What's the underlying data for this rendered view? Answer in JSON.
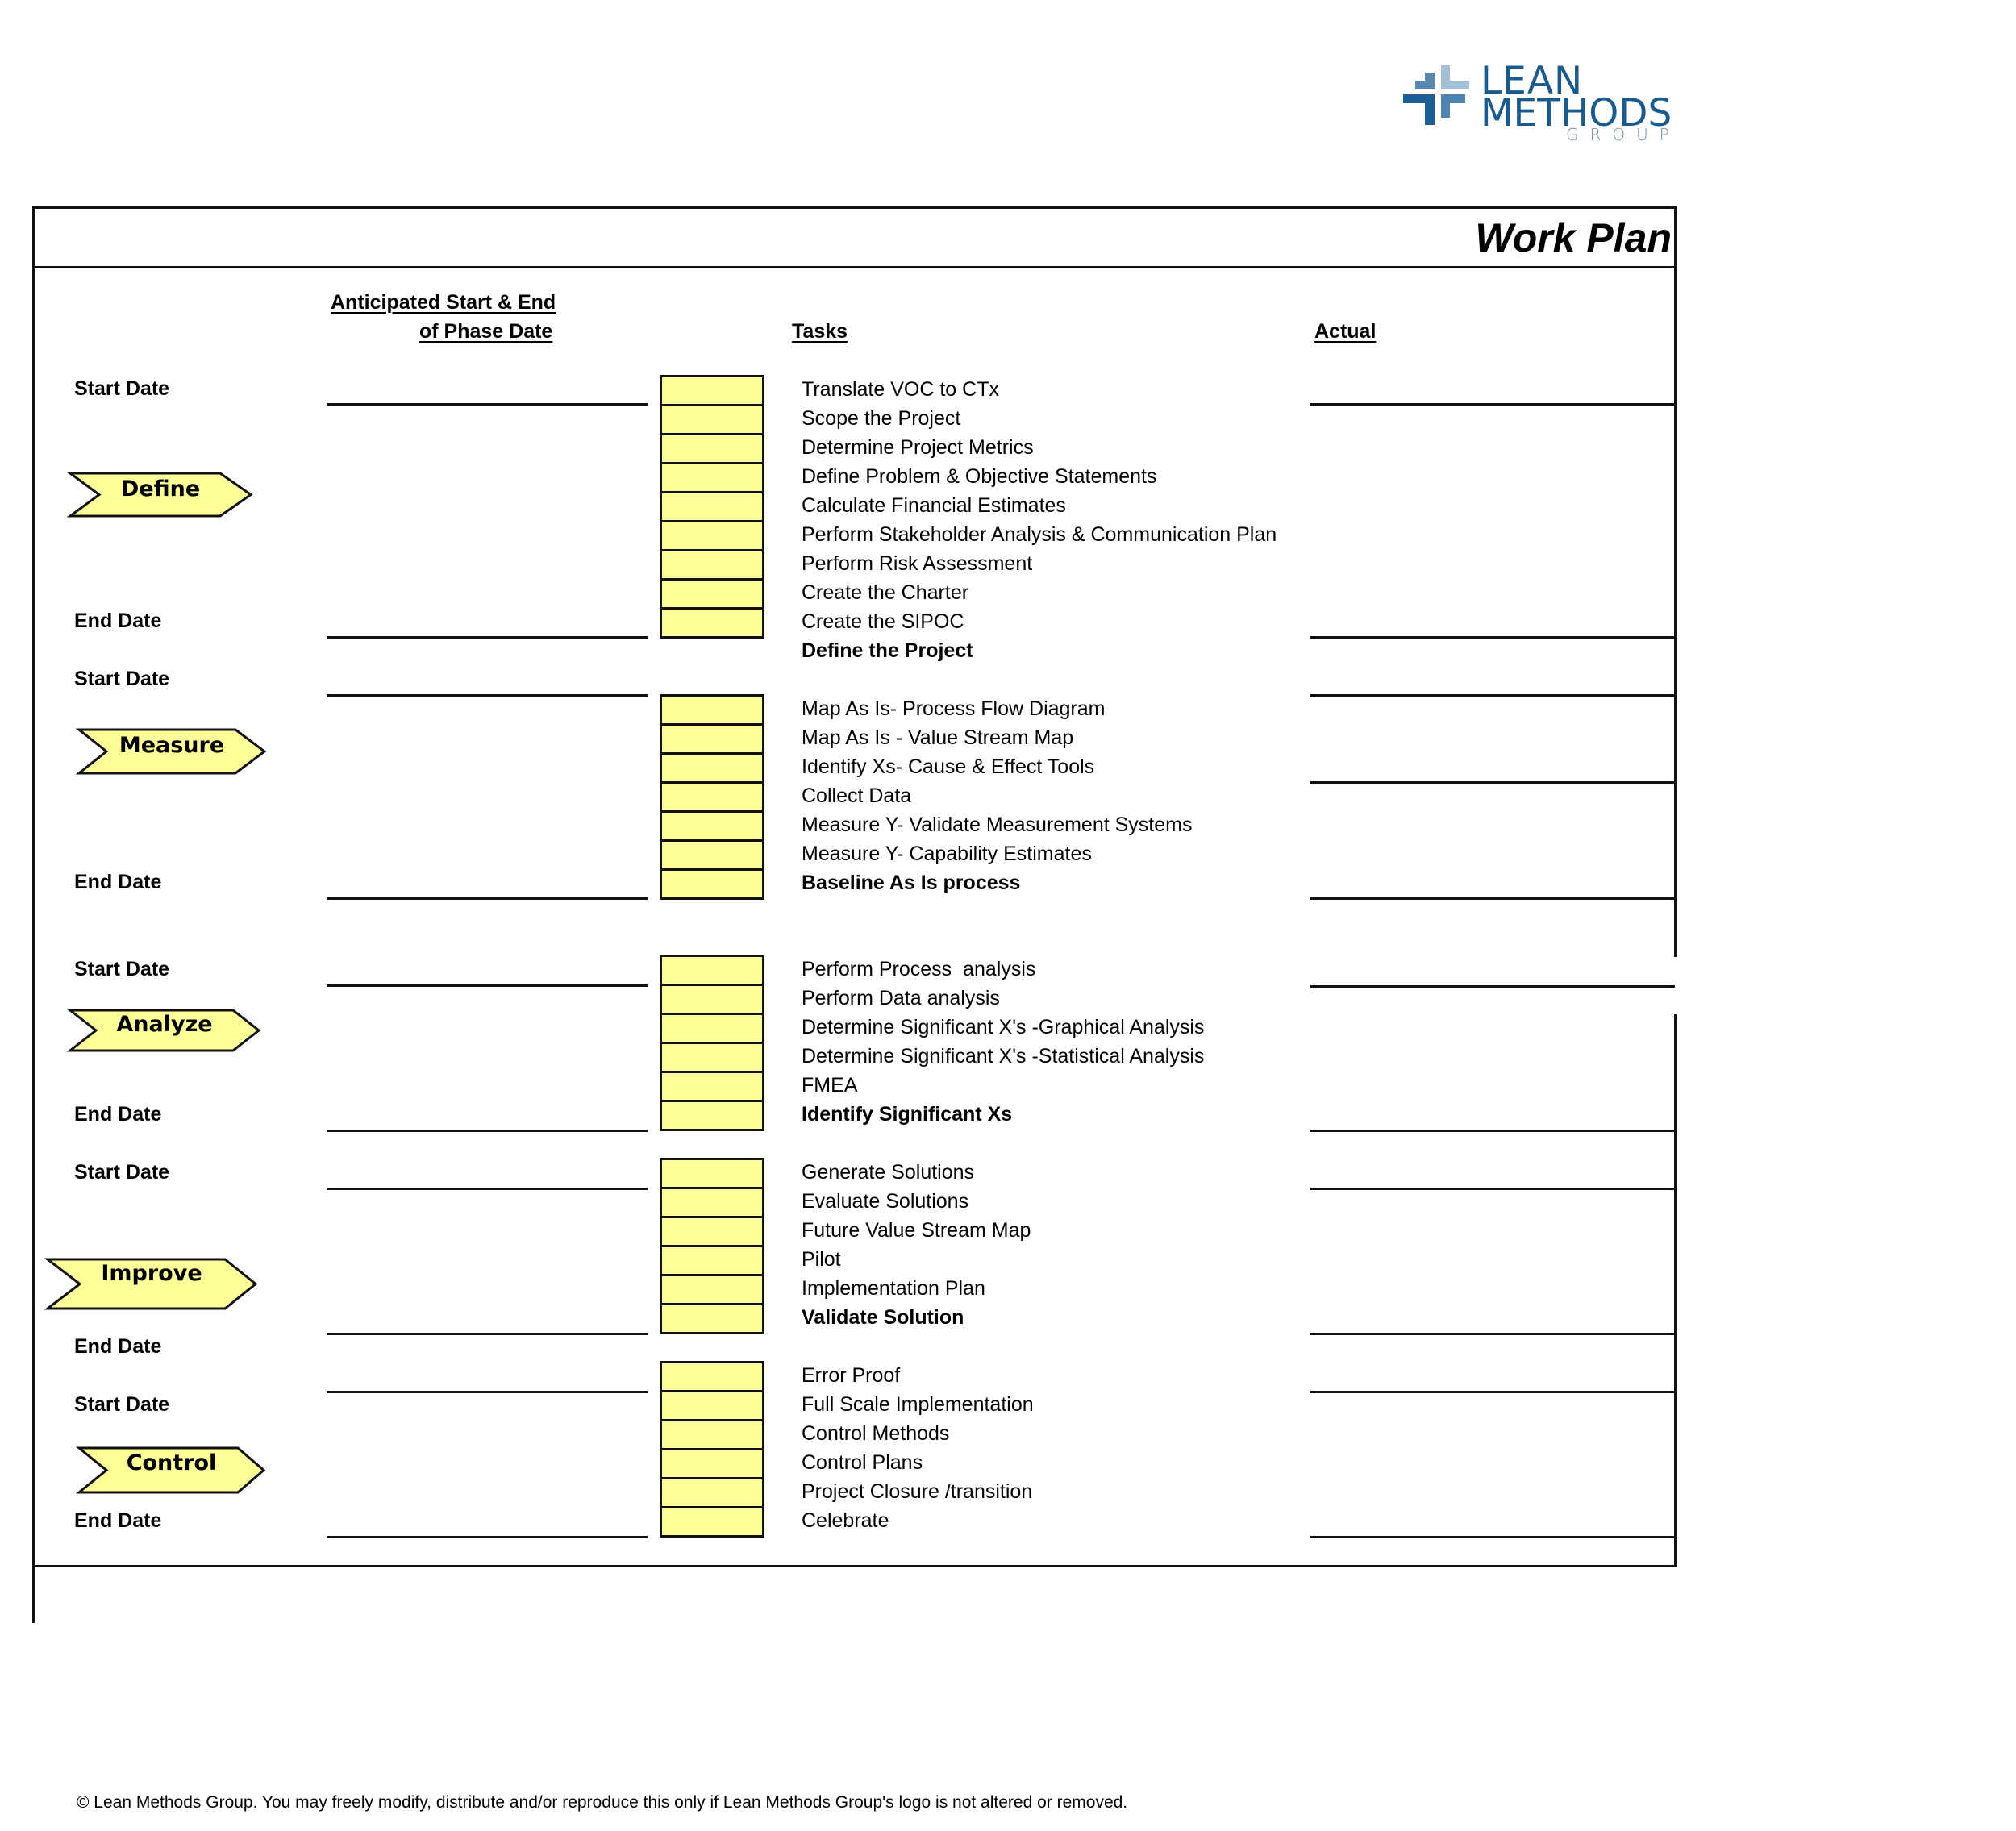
{
  "logo": {
    "line1": "LEAN",
    "line2": "METHODS",
    "line3": "GROUP",
    "colors": {
      "dark": "#1c5f96",
      "mid": "#4f83b0",
      "mid_light": "#5b87ad",
      "light": "#a4bfd5",
      "text": "#1b5a8d",
      "group_text": "#6f8ea6"
    }
  },
  "document": {
    "title": "Work Plan",
    "box_fill": "#ffff99"
  },
  "headers": {
    "anticipated_line1": "Anticipated Start & End",
    "anticipated_line2": "of Phase Date",
    "tasks": "Tasks",
    "actual": "Actual"
  },
  "labels": {
    "start_date": "Start Date",
    "end_date": "End Date"
  },
  "phases": [
    {
      "name": "Define",
      "start_date": "",
      "end_date": "",
      "actual_start": "",
      "actual_end": "",
      "tasks": [
        {
          "label": "Translate VOC to CTx",
          "bold": false,
          "checked": false
        },
        {
          "label": "Scope the Project",
          "bold": false,
          "checked": false
        },
        {
          "label": "Determine Project Metrics",
          "bold": false,
          "checked": false
        },
        {
          "label": "Define Problem & Objective Statements",
          "bold": false,
          "checked": false
        },
        {
          "label": "Calculate Financial Estimates",
          "bold": false,
          "checked": false
        },
        {
          "label": "Perform Stakeholder Analysis & Communication Plan",
          "bold": false,
          "checked": false
        },
        {
          "label": "Perform Risk Assessment",
          "bold": false,
          "checked": false
        },
        {
          "label": "Create the Charter",
          "bold": false,
          "checked": false
        },
        {
          "label": "Create the SIPOC",
          "bold": false,
          "checked": false
        }
      ],
      "milestone": "Define the Project"
    },
    {
      "name": "Measure",
      "start_date": "",
      "end_date": "",
      "actual_start": "",
      "actual_mid": "",
      "actual_end": "",
      "tasks": [
        {
          "label": "Map As Is- Process Flow Diagram",
          "bold": false,
          "checked": false
        },
        {
          "label": "Map As Is - Value Stream Map",
          "bold": false,
          "checked": false
        },
        {
          "label": "Identify Xs- Cause & Effect Tools",
          "bold": false,
          "checked": false
        },
        {
          "label": "Collect Data",
          "bold": false,
          "checked": false
        },
        {
          "label": "Measure Y- Validate Measurement Systems",
          "bold": false,
          "checked": false
        },
        {
          "label": "Measure Y- Capability Estimates",
          "bold": false,
          "checked": false
        },
        {
          "label": "Baseline As Is process",
          "bold": true,
          "checked": false
        }
      ]
    },
    {
      "name": "Analyze",
      "start_date": "",
      "end_date": "",
      "actual_start": "",
      "actual_end": "",
      "tasks": [
        {
          "label": "Perform Process  analysis",
          "bold": false,
          "checked": false
        },
        {
          "label": "Perform Data analysis",
          "bold": false,
          "checked": false
        },
        {
          "label": "Determine Significant X's -Graphical Analysis",
          "bold": false,
          "checked": false
        },
        {
          "label": "Determine Significant X's -Statistical Analysis",
          "bold": false,
          "checked": false
        },
        {
          "label": "FMEA",
          "bold": false,
          "checked": false
        },
        {
          "label": "Identify Significant Xs",
          "bold": true,
          "checked": false
        }
      ]
    },
    {
      "name": "Improve",
      "start_date": "",
      "end_date": "",
      "actual_start": "",
      "actual_end": "",
      "tasks": [
        {
          "label": "Generate Solutions",
          "bold": false,
          "checked": false
        },
        {
          "label": "Evaluate Solutions",
          "bold": false,
          "checked": false
        },
        {
          "label": "Future Value Stream Map",
          "bold": false,
          "checked": false
        },
        {
          "label": "Pilot",
          "bold": false,
          "checked": false
        },
        {
          "label": "Implementation Plan",
          "bold": false,
          "checked": false
        },
        {
          "label": "Validate Solution",
          "bold": true,
          "checked": false
        }
      ]
    },
    {
      "name": "Control",
      "start_date": "",
      "end_date": "",
      "actual_start": "",
      "actual_end": "",
      "tasks": [
        {
          "label": "Error Proof",
          "bold": false,
          "checked": false
        },
        {
          "label": "Full Scale Implementation",
          "bold": false,
          "checked": false
        },
        {
          "label": "Control Methods",
          "bold": false,
          "checked": false
        },
        {
          "label": "Control Plans",
          "bold": false,
          "checked": false
        },
        {
          "label": "Project Closure /transition",
          "bold": false,
          "checked": false
        },
        {
          "label": "Celebrate",
          "bold": false,
          "checked": false
        }
      ]
    }
  ],
  "footer": {
    "copyright": "© Lean Methods Group. You may freely modify, distribute and/or reproduce this only if Lean Methods Group's logo is not altered or removed."
  }
}
